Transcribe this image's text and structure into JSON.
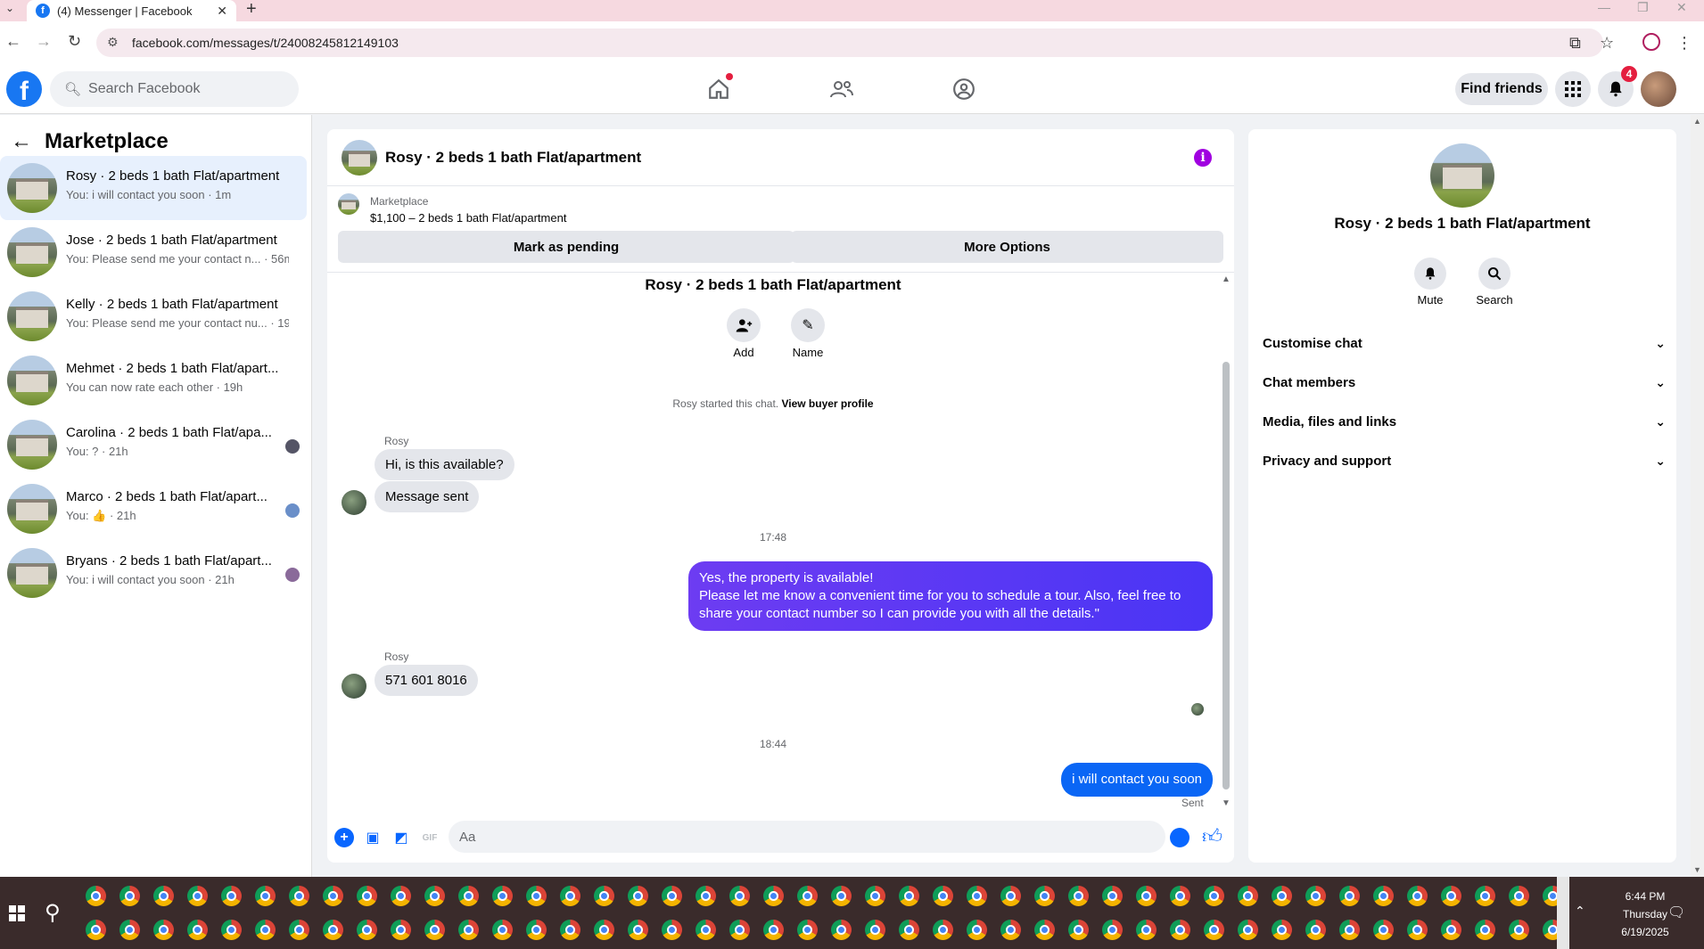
{
  "browser": {
    "tab_title": "(4) Messenger | Facebook",
    "url": "facebook.com/messages/t/24008245812149103"
  },
  "header": {
    "search_placeholder": "Search Facebook",
    "find_friends": "Find friends",
    "notification_count": "4"
  },
  "sidebar": {
    "title": "Marketplace",
    "conversations": [
      {
        "name": "Rosy · 2 beds 1 bath Flat/apartment",
        "snippet": "You: i will contact you soon · 1m",
        "active": true
      },
      {
        "name": "Jose · 2 beds 1 bath Flat/apartment",
        "snippet": "You: Please send me your contact n... · 56m"
      },
      {
        "name": "Kelly · 2 beds 1 bath Flat/apartment",
        "snippet": "You: Please send me your contact nu... · 19h"
      },
      {
        "name": "Mehmet · 2 beds 1 bath Flat/apart...",
        "snippet": "You can now rate each other · 19h"
      },
      {
        "name": "Carolina · 2 beds 1 bath Flat/apa...",
        "snippet": "You: ? · 21h"
      },
      {
        "name": "Marco · 2 beds 1 bath Flat/apart...",
        "snippet": "You: 👍 · 21h"
      },
      {
        "name": "Bryans · 2 beds 1 bath Flat/apart...",
        "snippet": "You: i will contact you soon · 21h"
      }
    ]
  },
  "chat": {
    "title": "Rosy · 2 beds 1 bath Flat/apartment",
    "marketplace_label": "Marketplace",
    "listing": "$1,100 – 2 beds 1 bath Flat/apartment",
    "mark_pending": "Mark as pending",
    "more_options": "More Options",
    "heading": "Rosy · 2 beds 1 bath Flat/apartment",
    "add_label": "Add",
    "name_label": "Name",
    "started_text": "Rosy started this chat.",
    "view_buyer": "View buyer profile",
    "sender1": "Rosy",
    "msg1": "Hi, is this available?",
    "msg2": "Message sent",
    "time1": "17:48",
    "out1_line1": "Yes, the property is available!",
    "out1_line2": "Please let me know a convenient time for you to schedule a tour. Also, feel free to share your contact number so I can provide you with all the details.\"",
    "sender2": "Rosy",
    "msg3": "571 601 8016",
    "time2": "18:44",
    "out2": "i will contact you soon",
    "sent_label": "Sent",
    "composer_placeholder": "Aa"
  },
  "right_panel": {
    "title": "Rosy · 2 beds 1 bath Flat/apartment",
    "mute": "Mute",
    "search": "Search",
    "rows": [
      "Customise chat",
      "Chat members",
      "Media, files and links",
      "Privacy and support"
    ]
  },
  "taskbar": {
    "time": "6:44 PM",
    "day": "Thursday",
    "date": "6/19/2025",
    "notif_count": "2"
  }
}
